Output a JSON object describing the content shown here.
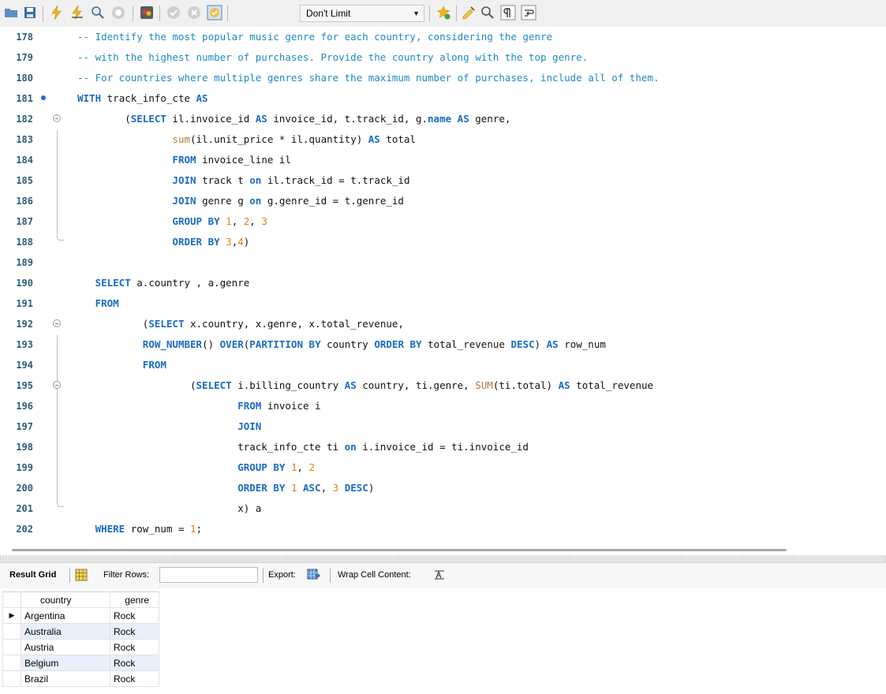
{
  "toolbar": {
    "limit_label": "Don't Limit",
    "icons": [
      "open-folder-icon",
      "save-icon",
      "execute-icon",
      "execute-current-icon",
      "explain-icon",
      "stop-icon",
      "toggle-output-icon",
      "commit-icon",
      "rollback-icon",
      "autocommit-icon",
      "limit-dropdown",
      "bookmark-star-icon",
      "beautify-icon",
      "find-icon",
      "invisible-chars-icon",
      "wrap-icon"
    ]
  },
  "editor": {
    "lines": [
      {
        "n": "178",
        "segs": [
          [
            "cm",
            "-- Identify the most popular music genre for each country, considering the genre"
          ]
        ]
      },
      {
        "n": "179",
        "segs": [
          [
            "cm",
            "-- with the highest number of purchases. Provide the country along with the top genre."
          ]
        ]
      },
      {
        "n": "180",
        "segs": [
          [
            "cm",
            "-- For countries where multiple genres share the maximum number of purchases, include all of them."
          ]
        ]
      },
      {
        "n": "181",
        "segs": [
          [
            "kw",
            "WITH "
          ],
          [
            "",
            "track_info_cte "
          ],
          [
            "kw",
            "AS"
          ]
        ]
      },
      {
        "n": "182",
        "segs": [
          [
            "",
            "        ("
          ],
          [
            "kw",
            "SELECT "
          ],
          [
            "",
            "il.invoice_id "
          ],
          [
            "kw",
            "AS "
          ],
          [
            "",
            "invoice_id, t.track_id, g."
          ],
          [
            "kw",
            "name "
          ],
          [
            "kw",
            "AS "
          ],
          [
            "",
            "genre,"
          ]
        ]
      },
      {
        "n": "183",
        "segs": [
          [
            "",
            "                "
          ],
          [
            "fn",
            "sum"
          ],
          [
            "",
            "(il.unit_price * il.quantity) "
          ],
          [
            "kw",
            "AS "
          ],
          [
            "",
            "total"
          ]
        ]
      },
      {
        "n": "184",
        "segs": [
          [
            "",
            "                "
          ],
          [
            "kw",
            "FROM "
          ],
          [
            "",
            "invoice_line il"
          ]
        ]
      },
      {
        "n": "185",
        "segs": [
          [
            "",
            "                "
          ],
          [
            "kw",
            "JOIN "
          ],
          [
            "",
            "track t "
          ],
          [
            "kw",
            "on "
          ],
          [
            "",
            "il.track_id = t.track_id"
          ]
        ]
      },
      {
        "n": "186",
        "segs": [
          [
            "",
            "                "
          ],
          [
            "kw",
            "JOIN "
          ],
          [
            "",
            "genre g "
          ],
          [
            "kw",
            "on "
          ],
          [
            "",
            "g.genre_id = t.genre_id"
          ]
        ]
      },
      {
        "n": "187",
        "segs": [
          [
            "",
            "                "
          ],
          [
            "kw",
            "GROUP BY "
          ],
          [
            "num",
            "1"
          ],
          [
            "",
            ", "
          ],
          [
            "num",
            "2"
          ],
          [
            "",
            ", "
          ],
          [
            "num",
            "3"
          ]
        ]
      },
      {
        "n": "188",
        "segs": [
          [
            "",
            "                "
          ],
          [
            "kw",
            "ORDER BY "
          ],
          [
            "num",
            "3"
          ],
          [
            "",
            ","
          ],
          [
            "num",
            "4"
          ],
          [
            "",
            ")"
          ]
        ]
      },
      {
        "n": "189",
        "segs": []
      },
      {
        "n": "190",
        "segs": [
          [
            "",
            "   "
          ],
          [
            "kw",
            "SELECT "
          ],
          [
            "",
            "a.country , a.genre"
          ]
        ]
      },
      {
        "n": "191",
        "segs": [
          [
            "",
            "   "
          ],
          [
            "kw",
            "FROM"
          ]
        ]
      },
      {
        "n": "192",
        "segs": [
          [
            "",
            "           ("
          ],
          [
            "kw",
            "SELECT "
          ],
          [
            "",
            "x.country, x.genre, x.total_revenue,"
          ]
        ]
      },
      {
        "n": "193",
        "segs": [
          [
            "",
            "           "
          ],
          [
            "kw",
            "ROW_NUMBER"
          ],
          [
            "",
            "() "
          ],
          [
            "kw",
            "OVER"
          ],
          [
            "",
            "("
          ],
          [
            "kw",
            "PARTITION BY "
          ],
          [
            "",
            "country "
          ],
          [
            "kw",
            "ORDER BY "
          ],
          [
            "",
            "total_revenue "
          ],
          [
            "kw",
            "DESC"
          ],
          [
            "",
            ") "
          ],
          [
            "kw",
            "AS "
          ],
          [
            "",
            "row_num"
          ]
        ]
      },
      {
        "n": "194",
        "segs": [
          [
            "",
            "           "
          ],
          [
            "kw",
            "FROM"
          ]
        ]
      },
      {
        "n": "195",
        "segs": [
          [
            "",
            "                   ("
          ],
          [
            "kw",
            "SELECT "
          ],
          [
            "",
            "i.billing_country "
          ],
          [
            "kw",
            "AS "
          ],
          [
            "",
            "country, ti.genre, "
          ],
          [
            "fn",
            "SUM"
          ],
          [
            "",
            "(ti.total) "
          ],
          [
            "kw",
            "AS "
          ],
          [
            "",
            "total_revenue"
          ]
        ]
      },
      {
        "n": "196",
        "segs": [
          [
            "",
            "                           "
          ],
          [
            "kw",
            "FROM "
          ],
          [
            "",
            "invoice i"
          ]
        ]
      },
      {
        "n": "197",
        "segs": [
          [
            "",
            "                           "
          ],
          [
            "kw",
            "JOIN"
          ]
        ]
      },
      {
        "n": "198",
        "segs": [
          [
            "",
            "                           track_info_cte ti "
          ],
          [
            "kw",
            "on "
          ],
          [
            "",
            "i.invoice_id = ti.invoice_id"
          ]
        ]
      },
      {
        "n": "199",
        "segs": [
          [
            "",
            "                           "
          ],
          [
            "kw",
            "GROUP BY "
          ],
          [
            "num",
            "1"
          ],
          [
            "",
            ", "
          ],
          [
            "num",
            "2"
          ]
        ]
      },
      {
        "n": "200",
        "segs": [
          [
            "",
            "                           "
          ],
          [
            "kw",
            "ORDER BY "
          ],
          [
            "num",
            "1 "
          ],
          [
            "kw",
            "ASC"
          ],
          [
            "",
            ", "
          ],
          [
            "num",
            "3 "
          ],
          [
            "kw",
            "DESC"
          ],
          [
            "",
            ")"
          ]
        ]
      },
      {
        "n": "201",
        "segs": [
          [
            "",
            "                           x) a"
          ]
        ]
      },
      {
        "n": "202",
        "segs": [
          [
            "",
            "   "
          ],
          [
            "kw",
            "WHERE "
          ],
          [
            "",
            "row_num = "
          ],
          [
            "num",
            "1"
          ],
          [
            "",
            ";"
          ]
        ]
      }
    ]
  },
  "result_bar": {
    "result_grid_label": "Result Grid",
    "filter_label": "Filter Rows:",
    "export_label": "Export:",
    "wrap_label": "Wrap Cell Content:"
  },
  "grid": {
    "columns": [
      "country",
      "genre"
    ],
    "rows": [
      [
        "Argentina",
        "Rock"
      ],
      [
        "Australia",
        "Rock"
      ],
      [
        "Austria",
        "Rock"
      ],
      [
        "Belgium",
        "Rock"
      ],
      [
        "Brazil",
        "Rock"
      ]
    ]
  }
}
